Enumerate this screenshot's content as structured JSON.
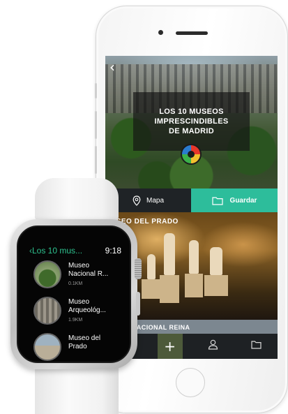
{
  "phone": {
    "hero": {
      "title_line1": "LOS 10 MUSEOS",
      "title_line2": "IMPRESCINDIBLES",
      "title_line3": "DE MADRID"
    },
    "actions": {
      "map_label": "Mapa",
      "save_label": "Guardar"
    },
    "cards": [
      {
        "title": "USEO DEL PRADO"
      },
      {
        "title": "USEO NACIONAL REINA"
      }
    ],
    "tab_bar": {
      "icons": [
        "lightbulb-icon",
        "plus-icon",
        "person-icon",
        "folder-icon"
      ],
      "plus_glyph": "+",
      "active_color": "#4d5a3a"
    },
    "colors": {
      "accent_green": "#2dbd9b",
      "dark_bar": "#1f2326"
    }
  },
  "watch": {
    "header": {
      "back_label": "‹Los 10 mus...",
      "time": "9:18"
    },
    "items": [
      {
        "name_line1": "Museo",
        "name_line2": "Nacional R...",
        "distance": "0.1KM"
      },
      {
        "name_line1": "Museo",
        "name_line2": "Arqueológ...",
        "distance": "1.9KM"
      },
      {
        "name_line1": "Museo del",
        "name_line2": "Prado",
        "distance": ""
      }
    ],
    "colors": {
      "accent_green": "#2ec28f"
    }
  }
}
